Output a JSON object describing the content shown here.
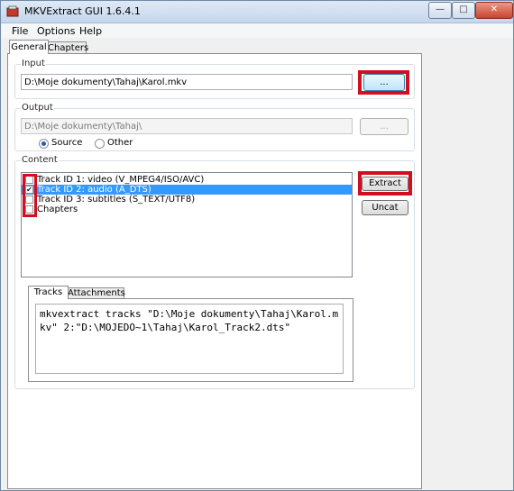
{
  "window": {
    "title": "MKVExtract GUI 1.6.4.1",
    "controls": {
      "minimize": "—",
      "maximize": "□",
      "close": "✕"
    }
  },
  "menu": [
    "File",
    "Options",
    "Help"
  ],
  "tabs": [
    "General",
    "Chapters"
  ],
  "input": {
    "label": "Input",
    "path": "D:\\Moje dokumenty\\Tahaj\\Karol.mkv",
    "browse_label": "..."
  },
  "output": {
    "label": "Output",
    "path": "D:\\Moje dokumenty\\Tahaj\\",
    "browse_label": "...",
    "radio_source": "Source",
    "radio_other": "Other",
    "selected": "Source"
  },
  "content": {
    "label": "Content",
    "tracks": [
      {
        "label": "Track ID 1: video (V_MPEG4/ISO/AVC)",
        "checked": false,
        "selected": false
      },
      {
        "label": "Track ID 2: audio (A_DTS)",
        "checked": true,
        "selected": true
      },
      {
        "label": "Track ID 3: subtitles (S_TEXT/UTF8)",
        "checked": false,
        "selected": false
      },
      {
        "label": "Chapters",
        "checked": false,
        "selected": false
      }
    ],
    "extract_label": "Extract",
    "uncat_label": "Uncat"
  },
  "inner_tabs": [
    "Tracks",
    "Attachments"
  ],
  "command": "mkvextract tracks \"D:\\Moje dokumenty\\Tahaj\\Karol.mkv\" 2:\"D:\\MOJEDO~1\\Tahaj\\Karol_Track2.dts\"",
  "colors": {
    "highlight_red": "#d01020",
    "selection_blue": "#3399ff"
  }
}
